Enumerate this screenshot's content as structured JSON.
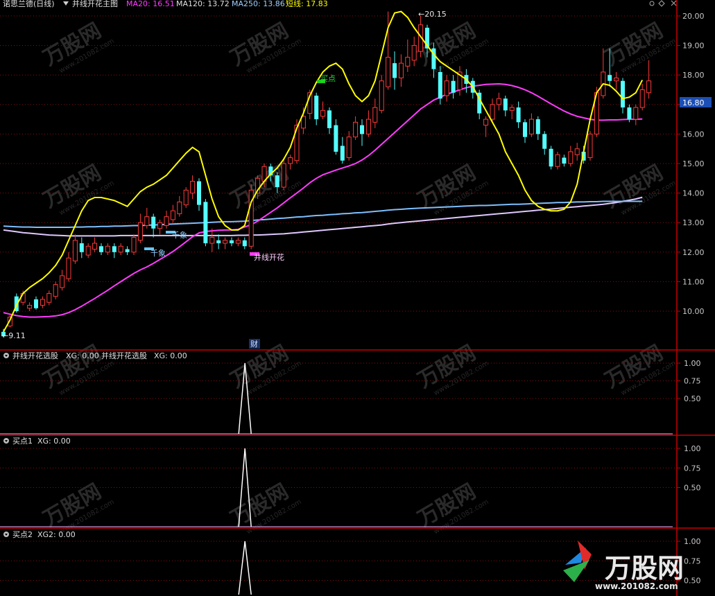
{
  "main": {
    "stock_title": "诺思兰德(日线)",
    "indicator_name": "并线开花主图",
    "ma20_label": "MA20: 16.51",
    "ma120_label": "MA120: 13.72",
    "ma250_label": "MA250: 13.86",
    "short_label": "短线: 17.83",
    "price_badge": "16.80",
    "high_marker": "20.15",
    "low_marker": "9.11",
    "annotations": {
      "buy_point": "买点",
      "thousand_a": "千象",
      "thousand_b": "千象",
      "bloom": "并线开花",
      "cai": "财"
    }
  },
  "sub1": {
    "title": "并线开花选股",
    "xg1": "XG: 0.00",
    "title2": "并线开花选股",
    "xg2": "XG: 0.00"
  },
  "sub2": {
    "title": "买点1",
    "xg": "XG: 0.00"
  },
  "sub3": {
    "title": "买点2",
    "xg": "XG2: 0.00"
  },
  "watermark": {
    "brand": "万股网",
    "url": "www.201082.com"
  },
  "colors": {
    "up": "#ff3b3b",
    "down": "#54ffff",
    "ma20": "#ff3cff",
    "ma120": "#7fbfff",
    "ma250": "#e0c8ff",
    "short": "#ffff00",
    "grid": "#8a1010",
    "axis": "#c80000"
  },
  "chart_data": [
    {
      "type": "candlestick",
      "y_axis_ticks": [
        10.0,
        11.0,
        12.0,
        13.0,
        14.0,
        15.0,
        16.0,
        17.0,
        18.0,
        19.0,
        20.0
      ],
      "ylim": [
        9.0,
        20.25
      ],
      "candles": [
        [
          9.3,
          9.15,
          9.4,
          9.11
        ],
        [
          9.5,
          9.8,
          9.9,
          9.45
        ],
        [
          10.5,
          10.0,
          10.6,
          9.95
        ],
        [
          10.3,
          10.6,
          10.7,
          10.2
        ],
        [
          10.1,
          10.2,
          10.3,
          10.0
        ],
        [
          10.4,
          10.1,
          10.5,
          10.05
        ],
        [
          10.2,
          10.4,
          10.5,
          10.1
        ],
        [
          10.3,
          10.6,
          10.7,
          10.2
        ],
        [
          10.5,
          10.9,
          11.0,
          10.4
        ],
        [
          10.8,
          11.2,
          11.4,
          10.7
        ],
        [
          11.1,
          11.8,
          12.0,
          11.0
        ],
        [
          11.7,
          12.4,
          12.6,
          11.6
        ],
        [
          12.3,
          12.0,
          12.5,
          11.8
        ],
        [
          11.9,
          12.2,
          12.3,
          11.8
        ],
        [
          12.1,
          12.3,
          12.5,
          12.0
        ],
        [
          12.2,
          12.0,
          12.3,
          11.9
        ],
        [
          12.0,
          12.2,
          12.3,
          11.9
        ],
        [
          12.2,
          12.0,
          12.3,
          11.8
        ],
        [
          12.0,
          12.2,
          12.3,
          11.9
        ],
        [
          12.1,
          12.0,
          12.2,
          11.9
        ],
        [
          12.0,
          12.5,
          12.6,
          11.9
        ],
        [
          12.4,
          13.0,
          13.3,
          12.3
        ],
        [
          12.9,
          13.2,
          13.5,
          12.8
        ],
        [
          13.2,
          12.8,
          13.3,
          12.5
        ],
        [
          12.8,
          13.0,
          13.1,
          12.6
        ],
        [
          12.9,
          13.2,
          13.4,
          12.8
        ],
        [
          13.1,
          13.4,
          13.6,
          13.0
        ],
        [
          13.3,
          13.7,
          13.9,
          13.2
        ],
        [
          13.6,
          14.1,
          14.2,
          13.5
        ],
        [
          14.0,
          14.4,
          14.6,
          13.8
        ],
        [
          14.4,
          13.6,
          14.5,
          13.4
        ],
        [
          13.7,
          12.3,
          13.8,
          12.2
        ],
        [
          12.3,
          12.5,
          12.8,
          12.0
        ],
        [
          12.4,
          12.3,
          12.6,
          12.1
        ],
        [
          12.3,
          12.4,
          12.5,
          12.1
        ],
        [
          12.4,
          12.3,
          12.5,
          12.2
        ],
        [
          12.3,
          12.4,
          12.5,
          12.2
        ],
        [
          12.4,
          12.2,
          12.5,
          12.1
        ],
        [
          12.2,
          14.1,
          14.3,
          12.1
        ],
        [
          14.0,
          14.5,
          14.6,
          13.8
        ],
        [
          14.4,
          14.9,
          15.0,
          14.2
        ],
        [
          14.9,
          14.6,
          15.0,
          14.4
        ],
        [
          14.6,
          14.2,
          14.7,
          14.0
        ],
        [
          14.2,
          15.0,
          15.2,
          14.1
        ],
        [
          15.0,
          15.2,
          15.3,
          14.8
        ],
        [
          15.1,
          16.3,
          16.5,
          15.0
        ],
        [
          16.2,
          16.6,
          16.9,
          16.0
        ],
        [
          16.7,
          17.4,
          17.5,
          16.5
        ],
        [
          17.3,
          16.5,
          17.4,
          16.3
        ],
        [
          16.6,
          16.8,
          17.1,
          16.5
        ],
        [
          16.8,
          16.2,
          16.9,
          16.0
        ],
        [
          16.3,
          15.4,
          16.5,
          15.3
        ],
        [
          15.6,
          15.1,
          15.9,
          15.0
        ],
        [
          15.2,
          15.9,
          16.1,
          15.1
        ],
        [
          15.9,
          16.4,
          16.6,
          15.8
        ],
        [
          16.3,
          16.0,
          16.5,
          15.6
        ],
        [
          16.0,
          16.5,
          16.8,
          15.9
        ],
        [
          16.4,
          16.9,
          17.2,
          16.2
        ],
        [
          16.8,
          17.8,
          18.0,
          16.7
        ],
        [
          17.6,
          18.6,
          20.15,
          17.5
        ],
        [
          18.4,
          17.9,
          18.8,
          17.5
        ],
        [
          17.9,
          18.4,
          18.7,
          17.6
        ],
        [
          18.3,
          18.6,
          19.2,
          18.1
        ],
        [
          18.5,
          19.0,
          19.3,
          18.3
        ],
        [
          18.8,
          19.7,
          20.0,
          18.6
        ],
        [
          19.6,
          18.9,
          19.7,
          18.6
        ],
        [
          18.9,
          18.2,
          19.1,
          17.9
        ],
        [
          18.1,
          17.2,
          18.3,
          17.0
        ],
        [
          17.3,
          17.8,
          18.0,
          17.1
        ],
        [
          17.8,
          17.4,
          18.0,
          17.2
        ],
        [
          17.5,
          18.1,
          18.3,
          17.3
        ],
        [
          18.0,
          17.7,
          18.2,
          17.4
        ],
        [
          17.8,
          17.4,
          17.9,
          17.2
        ],
        [
          17.4,
          16.7,
          17.5,
          16.5
        ],
        [
          16.3,
          16.5,
          16.6,
          15.9
        ],
        [
          16.5,
          17.0,
          17.2,
          16.4
        ],
        [
          17.0,
          17.2,
          17.4,
          16.8
        ],
        [
          17.2,
          16.8,
          17.3,
          16.6
        ],
        [
          16.8,
          16.9,
          17.0,
          16.5
        ],
        [
          16.9,
          16.4,
          17.1,
          16.2
        ],
        [
          16.4,
          15.9,
          16.5,
          15.7
        ],
        [
          16.0,
          16.5,
          16.7,
          15.9
        ],
        [
          16.5,
          16.0,
          16.6,
          15.8
        ],
        [
          16.0,
          15.5,
          16.1,
          15.3
        ],
        [
          15.5,
          14.9,
          15.6,
          14.8
        ],
        [
          14.9,
          15.3,
          15.4,
          14.8
        ],
        [
          15.2,
          15.0,
          15.3,
          14.9
        ],
        [
          15.0,
          15.4,
          15.6,
          14.9
        ],
        [
          15.3,
          15.5,
          15.7,
          15.1
        ],
        [
          15.4,
          15.1,
          15.6,
          15.0
        ],
        [
          15.2,
          16.0,
          16.1,
          15.1
        ],
        [
          16.0,
          17.4,
          17.6,
          15.9
        ],
        [
          17.3,
          18.1,
          18.9,
          17.2
        ],
        [
          18.0,
          17.8,
          18.9,
          17.6
        ],
        [
          17.8,
          17.9,
          18.1,
          17.5
        ],
        [
          17.8,
          16.9,
          17.9,
          16.7
        ],
        [
          16.9,
          16.5,
          17.0,
          16.4
        ],
        [
          16.5,
          16.9,
          17.0,
          16.3
        ],
        [
          16.9,
          17.5,
          17.7,
          16.8
        ],
        [
          17.4,
          17.8,
          18.5,
          17.2
        ]
      ],
      "ma20": [
        9.95,
        9.9,
        9.85,
        9.82,
        9.8,
        9.8,
        9.81,
        9.82,
        9.84,
        9.88,
        9.95,
        10.05,
        10.17,
        10.3,
        10.43,
        10.57,
        10.71,
        10.86,
        11.0,
        11.14,
        11.28,
        11.4,
        11.5,
        11.62,
        11.75,
        11.88,
        12.02,
        12.18,
        12.35,
        12.52,
        12.65,
        12.7,
        12.72,
        12.74,
        12.75,
        12.75,
        12.77,
        12.85,
        12.93,
        13.05,
        13.2,
        13.35,
        13.5,
        13.67,
        13.84,
        14.0,
        14.17,
        14.35,
        14.5,
        14.62,
        14.7,
        14.78,
        14.85,
        14.92,
        15.0,
        15.12,
        15.27,
        15.45,
        15.65,
        15.85,
        16.05,
        16.25,
        16.45,
        16.65,
        16.85,
        17.0,
        17.15,
        17.25,
        17.35,
        17.42,
        17.5,
        17.57,
        17.62,
        17.65,
        17.68,
        17.69,
        17.7,
        17.68,
        17.64,
        17.58,
        17.5,
        17.4,
        17.28,
        17.15,
        17.02,
        16.9,
        16.78,
        16.68,
        16.6,
        16.55,
        16.5,
        16.47,
        16.47,
        16.48,
        16.48,
        16.49,
        16.5,
        16.5,
        16.51
      ],
      "ma120": [
        12.88,
        12.87,
        12.86,
        12.85,
        12.85,
        12.84,
        12.84,
        12.84,
        12.84,
        12.84,
        12.84,
        12.85,
        12.85,
        12.86,
        12.86,
        12.87,
        12.87,
        12.88,
        12.88,
        12.89,
        12.9,
        12.9,
        12.91,
        12.92,
        12.93,
        12.94,
        12.95,
        12.96,
        12.97,
        12.98,
        12.99,
        13.0,
        13.01,
        13.02,
        13.03,
        13.03,
        13.04,
        13.05,
        13.07,
        13.09,
        13.1,
        13.12,
        13.14,
        13.15,
        13.17,
        13.19,
        13.2,
        13.22,
        13.24,
        13.25,
        13.27,
        13.28,
        13.3,
        13.31,
        13.33,
        13.34,
        13.36,
        13.38,
        13.4,
        13.42,
        13.44,
        13.45,
        13.47,
        13.48,
        13.49,
        13.5,
        13.51,
        13.52,
        13.53,
        13.54,
        13.55,
        13.56,
        13.57,
        13.58,
        13.58,
        13.59,
        13.6,
        13.61,
        13.62,
        13.62,
        13.63,
        13.64,
        13.65,
        13.66,
        13.67,
        13.68,
        13.68,
        13.69,
        13.7,
        13.7,
        13.71,
        13.71,
        13.72,
        13.72,
        13.72,
        13.72,
        13.72,
        13.72,
        13.72
      ],
      "ma250": [
        12.75,
        12.72,
        12.69,
        12.66,
        12.64,
        12.62,
        12.6,
        12.58,
        12.57,
        12.56,
        12.55,
        12.55,
        12.55,
        12.55,
        12.55,
        12.55,
        12.55,
        12.55,
        12.56,
        12.56,
        12.56,
        12.56,
        12.56,
        12.56,
        12.56,
        12.56,
        12.56,
        12.56,
        12.56,
        12.56,
        12.56,
        12.56,
        12.56,
        12.56,
        12.56,
        12.56,
        12.57,
        12.57,
        12.58,
        12.58,
        12.59,
        12.6,
        12.61,
        12.62,
        12.64,
        12.66,
        12.68,
        12.7,
        12.72,
        12.74,
        12.76,
        12.78,
        12.8,
        12.82,
        12.84,
        12.86,
        12.88,
        12.9,
        12.92,
        12.95,
        12.98,
        13.0,
        13.02,
        13.04,
        13.06,
        13.08,
        13.1,
        13.12,
        13.14,
        13.16,
        13.18,
        13.2,
        13.22,
        13.24,
        13.26,
        13.28,
        13.3,
        13.32,
        13.34,
        13.36,
        13.38,
        13.4,
        13.42,
        13.44,
        13.46,
        13.48,
        13.5,
        13.52,
        13.54,
        13.56,
        13.58,
        13.6,
        13.62,
        13.65,
        13.68,
        13.72,
        13.76,
        13.8,
        13.86
      ],
      "short": [
        9.3,
        9.7,
        10.2,
        10.6,
        10.8,
        10.95,
        11.1,
        11.3,
        11.55,
        11.9,
        12.4,
        12.9,
        13.4,
        13.75,
        13.85,
        13.85,
        13.8,
        13.75,
        13.65,
        13.55,
        13.8,
        14.05,
        14.2,
        14.3,
        14.45,
        14.6,
        14.85,
        15.1,
        15.35,
        15.55,
        15.4,
        14.6,
        13.8,
        13.2,
        12.9,
        12.75,
        12.75,
        12.9,
        13.7,
        14.1,
        14.4,
        14.65,
        14.85,
        15.15,
        15.55,
        16.2,
        16.7,
        17.3,
        17.75,
        18.1,
        18.3,
        18.4,
        18.2,
        17.7,
        17.3,
        17.1,
        17.3,
        17.8,
        18.7,
        19.6,
        20.1,
        20.15,
        19.95,
        19.6,
        19.3,
        19.0,
        18.7,
        18.45,
        18.3,
        18.15,
        18.0,
        17.85,
        17.6,
        17.2,
        16.8,
        16.4,
        16.0,
        15.4,
        15.0,
        14.6,
        14.1,
        13.75,
        13.55,
        13.45,
        13.4,
        13.4,
        13.45,
        13.7,
        14.3,
        15.4,
        16.5,
        17.4,
        17.7,
        17.65,
        17.45,
        17.2,
        17.25,
        17.4,
        17.83
      ],
      "annotations": [
        "买点",
        "千象",
        "千象",
        "并线开花",
        "财"
      ]
    },
    {
      "type": "line",
      "title": "并线开花选股",
      "y_axis_ticks": [
        1.0,
        0.75,
        0.5
      ],
      "spike_index": 38,
      "values": "0 everywhere except 1 at spike_index"
    },
    {
      "type": "line",
      "title": "买点1",
      "y_axis_ticks": [
        1.0,
        0.75,
        0.5
      ],
      "spike_index": 38
    },
    {
      "type": "line",
      "title": "买点2",
      "y_axis_ticks": [
        1.0,
        0.75,
        0.5
      ],
      "spike_index": 38
    }
  ]
}
